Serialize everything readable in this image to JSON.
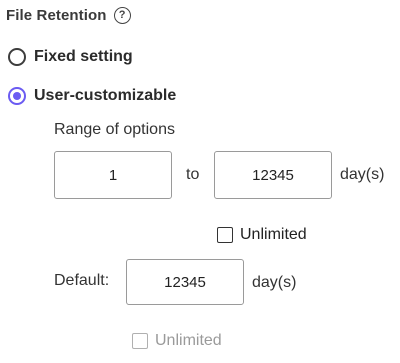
{
  "section": {
    "title": "File Retention",
    "help_icon": "help-circle-icon"
  },
  "options": {
    "fixed_label": "Fixed setting",
    "custom_label": "User-customizable",
    "selected": "custom",
    "accent": "#6b5bf2"
  },
  "range": {
    "label": "Range of options",
    "min_value": "1",
    "to_label": "to",
    "max_value": "12345",
    "unit": "day(s)",
    "unlimited_label": "Unlimited",
    "unlimited_checked": false
  },
  "default": {
    "label": "Default:",
    "value": "12345",
    "unit": "day(s)",
    "unlimited_label": "Unlimited",
    "unlimited_checked": false,
    "unlimited_disabled": true
  }
}
